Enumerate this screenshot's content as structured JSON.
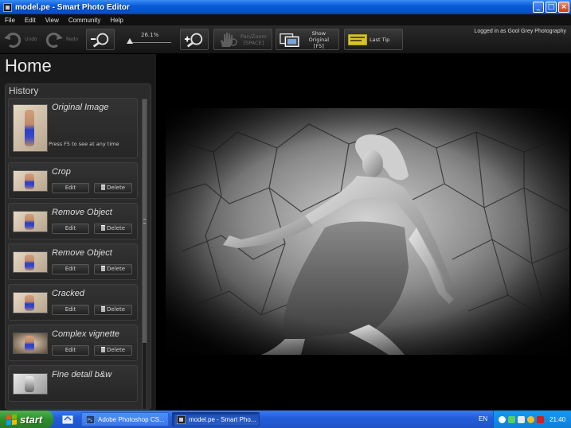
{
  "window": {
    "title": "model.pe - Smart Photo Editor",
    "controls": [
      "_",
      "□",
      "×"
    ]
  },
  "menu": [
    "File",
    "Edit",
    "View",
    "Community",
    "Help"
  ],
  "toolbar": {
    "undo": "Undo",
    "redo": "Redo",
    "zoom_value": "26.1%",
    "pan_zoom": "Pan/Zoom",
    "pan_zoom_key": "[SPACE]",
    "show_original": "Show Original",
    "show_original_key": "[F5]",
    "last_tip": "Last Tip",
    "logged_in": "Logged in as Gool Grey Photography"
  },
  "home": {
    "title": "Home",
    "history_title": "History",
    "original": {
      "name": "Original Image",
      "note": "Press F5 to see at any time"
    },
    "edit_label": "Edit",
    "delete_label": "Delete",
    "items": [
      {
        "name": "Crop"
      },
      {
        "name": "Remove Object"
      },
      {
        "name": "Remove Object"
      },
      {
        "name": "Cracked"
      },
      {
        "name": "Complex vignette"
      },
      {
        "name": "Fine detail b&w"
      }
    ]
  },
  "taskbar": {
    "start": "start",
    "tasks": [
      "Adobe Photoshop CS...",
      "model.pe - Smart Pho..."
    ],
    "lang": "EN",
    "clock": "21:40"
  },
  "colors": {
    "xp_blue": "#245edb",
    "start_green": "#3a9a3a",
    "panel_bg": "#1a1a1a",
    "item_bg": "#2b2b2b"
  }
}
